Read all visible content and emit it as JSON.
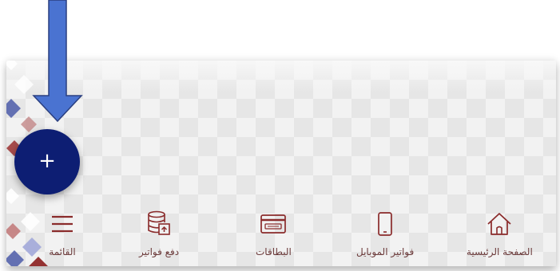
{
  "fab": {
    "label": "+"
  },
  "nav": {
    "menu": "القائمة",
    "pay_bills": "دفع فواتير",
    "cards": "البطاقات",
    "mobile_bills": "فواتير الموبايل",
    "home": "الصفحة الرئيسية"
  },
  "colors": {
    "fab": "#0d1e73",
    "arrow": "#4a73d1",
    "nav_text": "#6b3a3a",
    "icon": "#8a2b2b",
    "background": "#e8e8e8"
  },
  "icons": [
    "hamburger-icon",
    "database-upload-icon",
    "card-icon",
    "mobile-phone-icon",
    "home-icon"
  ]
}
